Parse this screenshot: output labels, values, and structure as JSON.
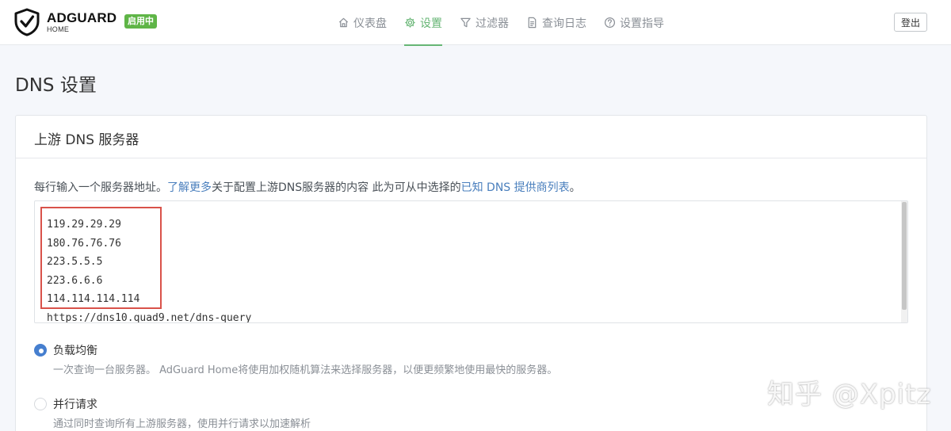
{
  "header": {
    "brand_name": "ADGUARD",
    "brand_sub": "HOME",
    "status_badge": "启用中",
    "nav": [
      {
        "label": "仪表盘",
        "icon": "home-icon"
      },
      {
        "label": "设置",
        "icon": "gear-icon",
        "active": true
      },
      {
        "label": "过滤器",
        "icon": "filter-icon"
      },
      {
        "label": "查询日志",
        "icon": "document-icon"
      },
      {
        "label": "设置指导",
        "icon": "help-circle-icon"
      }
    ],
    "logout_label": "登出"
  },
  "page": {
    "title": "DNS 设置"
  },
  "upstream": {
    "section_title": "上游 DNS 服务器",
    "desc_prefix": "每行输入一个服务器地址。",
    "desc_link1": "了解更多",
    "desc_middle": "关于配置上游DNS服务器的内容 此为可从中选择的",
    "desc_link2": "已知 DNS 提供商列表",
    "desc_suffix": "。",
    "servers": [
      "119.29.29.29",
      "180.76.76.76",
      "223.5.5.5",
      "223.6.6.6",
      "114.114.114.114",
      "https://dns10.quad9.net/dns-query"
    ],
    "modes": [
      {
        "label": "负载均衡",
        "help": "一次查询一台服务器。 AdGuard Home将使用加权随机算法来选择服务器，以便更频繁地使用最快的服务器。",
        "checked": true
      },
      {
        "label": "并行请求",
        "help": "通过同时查询所有上游服务器，使用并行请求以加速解析",
        "checked": false
      }
    ]
  },
  "watermark": "知乎 @Xpitz",
  "colors": {
    "accent_green": "#66b574",
    "badge_green": "#5fb547",
    "link_blue": "#4a7fbd",
    "radio_blue": "#467fcf",
    "highlight_red": "#d9524a"
  }
}
